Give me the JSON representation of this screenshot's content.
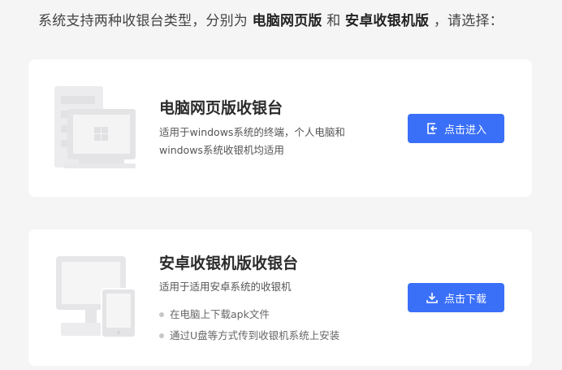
{
  "intro": {
    "prefix": "系统支持两种收银台类型，分别为 ",
    "option_web": "电脑网页版",
    "connector": " 和 ",
    "option_android": "安卓收银机版",
    "suffix": " ，请选择："
  },
  "cards": {
    "web": {
      "title": "电脑网页版收银台",
      "desc_line1": "适用于windows系统的终端，个人电脑和",
      "desc_line2": "windows系统收银机均适用",
      "button_label": "点击进入",
      "button_icon": "enter-icon",
      "illustration_icon": "windows-monitor-icon"
    },
    "android": {
      "title": "安卓收银机版收银台",
      "desc": "适用于适用安卓系统的收银机",
      "steps": [
        "在电脑上下载apk文件",
        "通过U盘等方式传到收银机系统上安装"
      ],
      "button_label": "点击下载",
      "button_icon": "download-icon",
      "illustration_icon": "pos-terminal-icon"
    }
  },
  "colors": {
    "accent": "#3a6ff7",
    "background": "#f5f5f6",
    "card": "#ffffff",
    "illustration": "#e9e9eb"
  }
}
